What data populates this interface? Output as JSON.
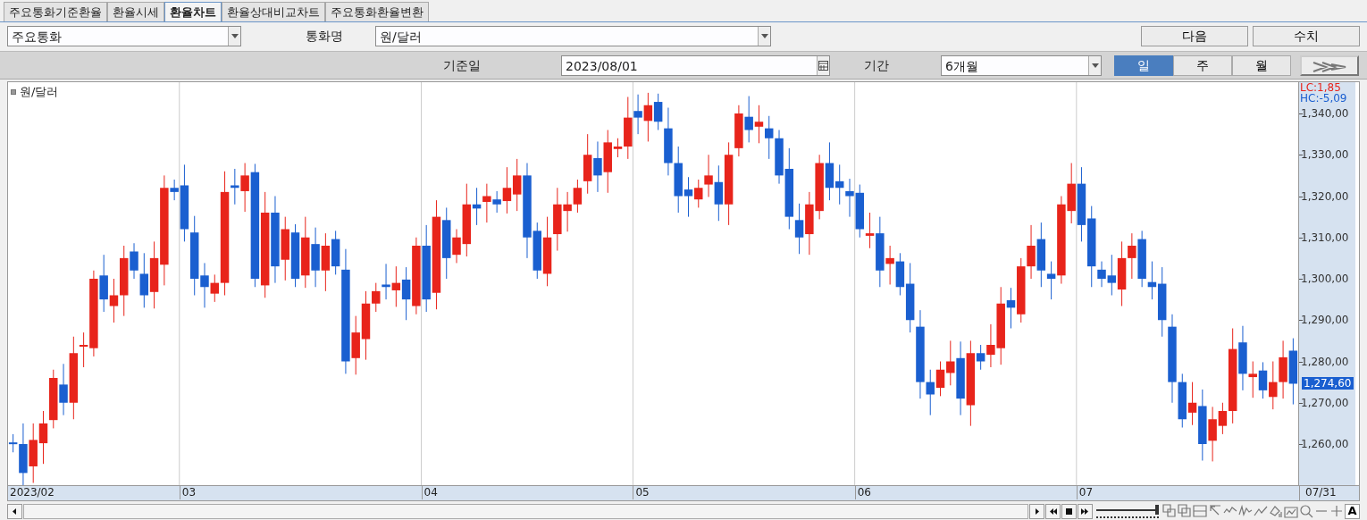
{
  "tabs": [
    {
      "label": "주요통화기준환율",
      "selected": false
    },
    {
      "label": "환율시세",
      "selected": false
    },
    {
      "label": "환율차트",
      "selected": true
    },
    {
      "label": "환율상대비교차트",
      "selected": false
    },
    {
      "label": "주요통화환율변환",
      "selected": false
    }
  ],
  "currency_group": {
    "value": "주요통화"
  },
  "currency_name": {
    "label": "통화명",
    "value": "원/달러"
  },
  "buttons": [
    "다음",
    "수치"
  ],
  "base_date": {
    "label": "기준일",
    "value": "2023/08/01"
  },
  "period": {
    "label": "기간",
    "value": "6개월"
  },
  "intervals": [
    {
      "label": "일",
      "selected": true
    },
    {
      "label": "주",
      "selected": false
    },
    {
      "label": "월",
      "selected": false
    }
  ],
  "chart": {
    "legend": "원/달러",
    "lc": "LC:1,85",
    "hc": "HC:-5,09",
    "y_ticks": [
      "1,340,00",
      "1,330,00",
      "1,320,00",
      "1,310,00",
      "1,300,00",
      "1,290,00",
      "1,280,00",
      "1,270,00",
      "1,260,00"
    ],
    "current_price": "1,274,60",
    "x_labels": [
      "2023/02",
      "03",
      "04",
      "05",
      "06",
      "07"
    ],
    "end_label": "07/31"
  },
  "toolbar": {
    "zoom_slider": {
      "level": 1
    },
    "font_button": "A"
  }
}
